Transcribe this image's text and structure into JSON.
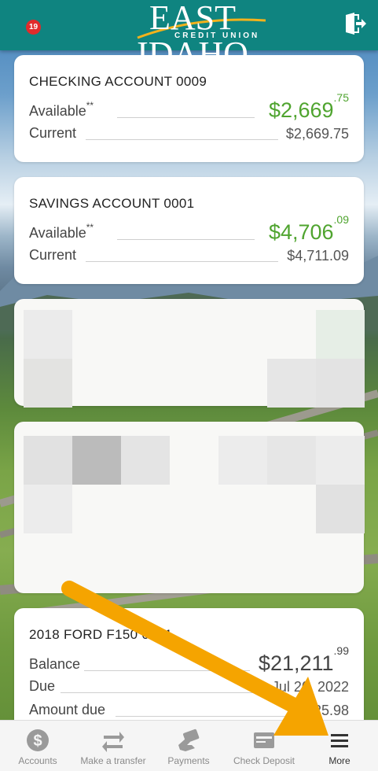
{
  "header": {
    "notification_count": "19",
    "logo_title": "EAST IDAHO",
    "logo_subtitle": "CREDIT UNION"
  },
  "accounts": [
    {
      "title": "CHECKING ACCOUNT 0009",
      "available_label": "Available",
      "available_marker": "**",
      "available_whole": "$2,669",
      "available_cents": ".75",
      "current_label": "Current",
      "current_value": "$2,669.75"
    },
    {
      "title": "SAVINGS ACCOUNT 0001",
      "available_label": "Available",
      "available_marker": "**",
      "available_whole": "$4,706",
      "available_cents": ".09",
      "current_label": "Current",
      "current_value": "$4,711.09"
    }
  ],
  "loan": {
    "title": "2018 FORD F150 0001",
    "balance_label": "Balance",
    "balance_whole": "$21,211",
    "balance_cents": ".99",
    "due_label": "Due",
    "due_value": "Jul 20, 2022",
    "amount_due_label": "Amount due",
    "amount_due_value": "$425.98"
  },
  "tabs": [
    {
      "label": "Accounts",
      "icon": "dollar-circle-icon"
    },
    {
      "label": "Make a transfer",
      "icon": "transfer-arrows-icon"
    },
    {
      "label": "Payments",
      "icon": "payment-card-hand-icon"
    },
    {
      "label": "Check Deposit",
      "icon": "check-deposit-icon"
    },
    {
      "label": "More",
      "icon": "hamburger-menu-icon"
    }
  ],
  "colors": {
    "header": "#0f8480",
    "available_green": "#4fa42f",
    "badge_red": "#e02b2b",
    "arrow_orange": "#f5a400"
  }
}
